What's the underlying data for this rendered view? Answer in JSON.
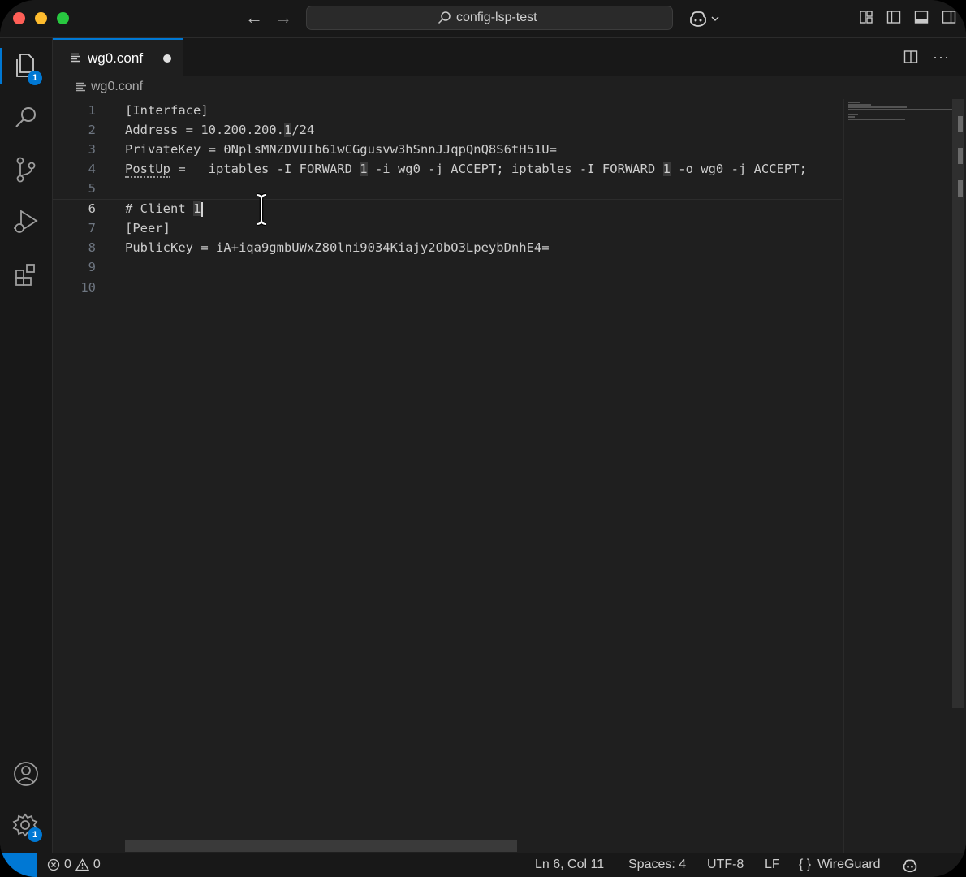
{
  "titlebar": {
    "search_text": "config-lsp-test"
  },
  "activity": {
    "explorer_badge": "1",
    "manage_badge": "1"
  },
  "tab": {
    "label": "wg0.conf"
  },
  "breadcrumb": {
    "file": "wg0.conf"
  },
  "editor": {
    "line_numbers": [
      "1",
      "2",
      "3",
      "4",
      "5",
      "6",
      "7",
      "8",
      "9",
      "10"
    ],
    "lines": {
      "l1": "[Interface]",
      "l2_a": "Address = 10.200.200.",
      "l2_b": "1",
      "l2_c": "/24",
      "l3": "PrivateKey = 0NplsMNZDVUIb61wCGgusvw3hSnnJJqpQnQ8S6tH51U=",
      "l4_a": "PostUp",
      "l4_b": " =   iptables -I FORWARD ",
      "l4_c": "1",
      "l4_d": " -i wg0 -j ACCEPT; iptables -I FORWARD ",
      "l4_e": "1",
      "l4_f": " -o wg0 -j ACCEPT;",
      "l6_a": "# Client ",
      "l6_b": "1",
      "l7": "[Peer]",
      "l8": "PublicKey = iA+iqa9gmbUWxZ80lni9034Kiajy2ObO3LpeybDnhE4="
    }
  },
  "statusbar": {
    "errors": "0",
    "warnings": "0",
    "position": "Ln 6, Col 11",
    "spaces": "Spaces: 4",
    "encoding": "UTF-8",
    "eol": "LF",
    "language": "WireGuard"
  },
  "colors": {
    "accent": "#0078d4",
    "editor_bg": "#1f1f1f",
    "chrome_bg": "#181818"
  },
  "icons": [
    "files-icon",
    "search-icon",
    "source-control-icon",
    "run-debug-icon",
    "extensions-icon",
    "account-icon",
    "manage-gear-icon",
    "copilot-icon",
    "split-editor-icon",
    "more-actions-icon"
  ]
}
